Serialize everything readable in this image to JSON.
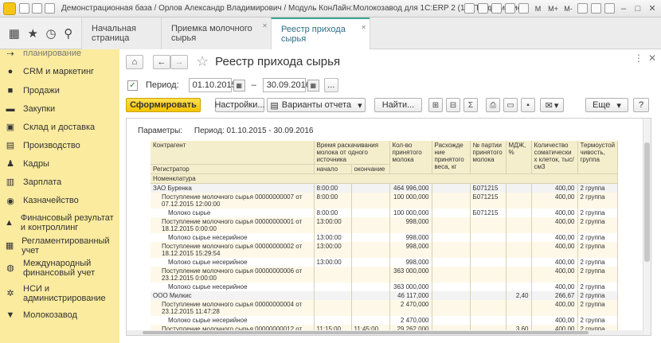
{
  "window": {
    "title": "Демонстрационная база / Орлов Александр Владимирович / Модуль КонЛайн:Молокозавод для 1С:ERP 2  (1С:Предприятие)",
    "controls": [
      "M",
      "M+",
      "M-"
    ]
  },
  "tabs": [
    {
      "label": "Начальная страница"
    },
    {
      "label": "Приемка молочного сырья"
    },
    {
      "label": "Реестр прихода сырья"
    }
  ],
  "sidebar": {
    "items": [
      {
        "label": "планирование",
        "icon": "arrows-icon"
      },
      {
        "label": "CRM и маркетинг",
        "icon": "crm-icon"
      },
      {
        "label": "Продажи",
        "icon": "bag-icon"
      },
      {
        "label": "Закупки",
        "icon": "cart-icon"
      },
      {
        "label": "Склад и доставка",
        "icon": "warehouse-icon"
      },
      {
        "label": "Производство",
        "icon": "factory-icon"
      },
      {
        "label": "Кадры",
        "icon": "people-icon"
      },
      {
        "label": "Зарплата",
        "icon": "salary-icon"
      },
      {
        "label": "Казначейство",
        "icon": "treasury-icon"
      },
      {
        "label": "Финансовый результат и контроллинг",
        "icon": "chart-icon"
      },
      {
        "label": "Регламентированный учет",
        "icon": "ledger-icon"
      },
      {
        "label": "Международный финансовый учет",
        "icon": "globe-icon"
      },
      {
        "label": "НСИ и администрирование",
        "icon": "gear-icon"
      },
      {
        "label": "Молокозавод",
        "icon": "milk-icon"
      }
    ]
  },
  "page": {
    "title": "Реестр прихода сырья",
    "period_label": "Период:",
    "date_from": "01.10.2015",
    "dash": "–",
    "date_to": "30.09.2016",
    "ellipsis": "..."
  },
  "commands": {
    "generate": "Сформировать",
    "settings": "Настройки...",
    "variants": "Варианты отчета",
    "find": "Найти...",
    "more": "Еще",
    "help": "?"
  },
  "report": {
    "params_label": "Параметры:",
    "params_value": "Период: 01.10.2015 - 30.09.2016",
    "headers": {
      "contractor": "Контрагент",
      "registrar": "Регистратор",
      "nomenclature": "Номенклатура",
      "time": "Время раскачивания молока от одного источника",
      "start": "начало",
      "end": "окончание",
      "qty": "Кол-во принятого молока",
      "diff": "Расхожде ние принятого веса, кг",
      "batch": "№ партии принятого молока",
      "fat": "МДЖ, %",
      "somatic": "Количество соматически х клеток, тыс/см3",
      "thermo": "Термоустой чивость, группа"
    },
    "rows": [
      {
        "type": "group",
        "name": "ЗАО Буренка",
        "start": "8:00:00",
        "end": "",
        "qty": "464 996,000",
        "diff": "",
        "batch": "Б071215",
        "fat": "",
        "somatic": "400,00",
        "thermo": "2 группа"
      },
      {
        "type": "doc",
        "name": "Поступление молочного сырья 00000000007 от 07.12.2015 12:00:00",
        "start": "8:00:00",
        "end": "",
        "qty": "100 000,000",
        "diff": "",
        "batch": "Б071215",
        "fat": "",
        "somatic": "400,00",
        "thermo": "2 группа"
      },
      {
        "type": "item",
        "name": "Молоко сырье",
        "start": "8:00:00",
        "end": "",
        "qty": "100 000,000",
        "diff": "",
        "batch": "Б071215",
        "fat": "",
        "somatic": "400,00",
        "thermo": "2 группа"
      },
      {
        "type": "doc",
        "name": "Поступление молочного сырья 00000000001 от 18.12.2015 0:00:00",
        "start": "13:00:00",
        "end": "",
        "qty": "998,000",
        "diff": "",
        "batch": "",
        "fat": "",
        "somatic": "400,00",
        "thermo": "2 группа"
      },
      {
        "type": "item",
        "name": "Молоко сырье несерийное",
        "start": "13:00:00",
        "end": "",
        "qty": "998,000",
        "diff": "",
        "batch": "",
        "fat": "",
        "somatic": "400,00",
        "thermo": "2 группа"
      },
      {
        "type": "doc",
        "name": "Поступление молочного сырья 00000000002 от 18.12.2015 15:29:54",
        "start": "13:00:00",
        "end": "",
        "qty": "998,000",
        "diff": "",
        "batch": "",
        "fat": "",
        "somatic": "400,00",
        "thermo": "2 группа"
      },
      {
        "type": "item",
        "name": "Молоко сырье несерийное",
        "start": "13:00:00",
        "end": "",
        "qty": "998,000",
        "diff": "",
        "batch": "",
        "fat": "",
        "somatic": "400,00",
        "thermo": "2 группа"
      },
      {
        "type": "doc",
        "name": "Поступление молочного сырья 00000000006 от 23.12.2015 0:00:00",
        "start": "",
        "end": "",
        "qty": "363 000,000",
        "diff": "",
        "batch": "",
        "fat": "",
        "somatic": "400,00",
        "thermo": "2 группа"
      },
      {
        "type": "item",
        "name": "Молоко сырье несерийное",
        "start": "",
        "end": "",
        "qty": "363 000,000",
        "diff": "",
        "batch": "",
        "fat": "",
        "somatic": "400,00",
        "thermo": "2 группа"
      },
      {
        "type": "group",
        "name": "ООО Милкис",
        "start": "",
        "end": "",
        "qty": "46 117,000",
        "diff": "",
        "batch": "",
        "fat": "2,40",
        "somatic": "266,67",
        "thermo": "2 группа"
      },
      {
        "type": "doc",
        "name": "Поступление молочного сырья 00000000004 от 23.12.2015 11:47:28",
        "start": "",
        "end": "",
        "qty": "2 470,000",
        "diff": "",
        "batch": "",
        "fat": "",
        "somatic": "400,00",
        "thermo": "2 группа"
      },
      {
        "type": "item",
        "name": "Молоко сырье несерийное",
        "start": "",
        "end": "",
        "qty": "2 470,000",
        "diff": "",
        "batch": "",
        "fat": "",
        "somatic": "400,00",
        "thermo": "2 группа"
      },
      {
        "type": "doc",
        "name": "Поступление молочного сырья 00000000012 от",
        "start": "11:15:00",
        "end": "11:45:00",
        "qty": "29 262,000",
        "diff": "",
        "batch": "",
        "fat": "3,60",
        "somatic": "400,00",
        "thermo": "2 группа"
      }
    ]
  }
}
